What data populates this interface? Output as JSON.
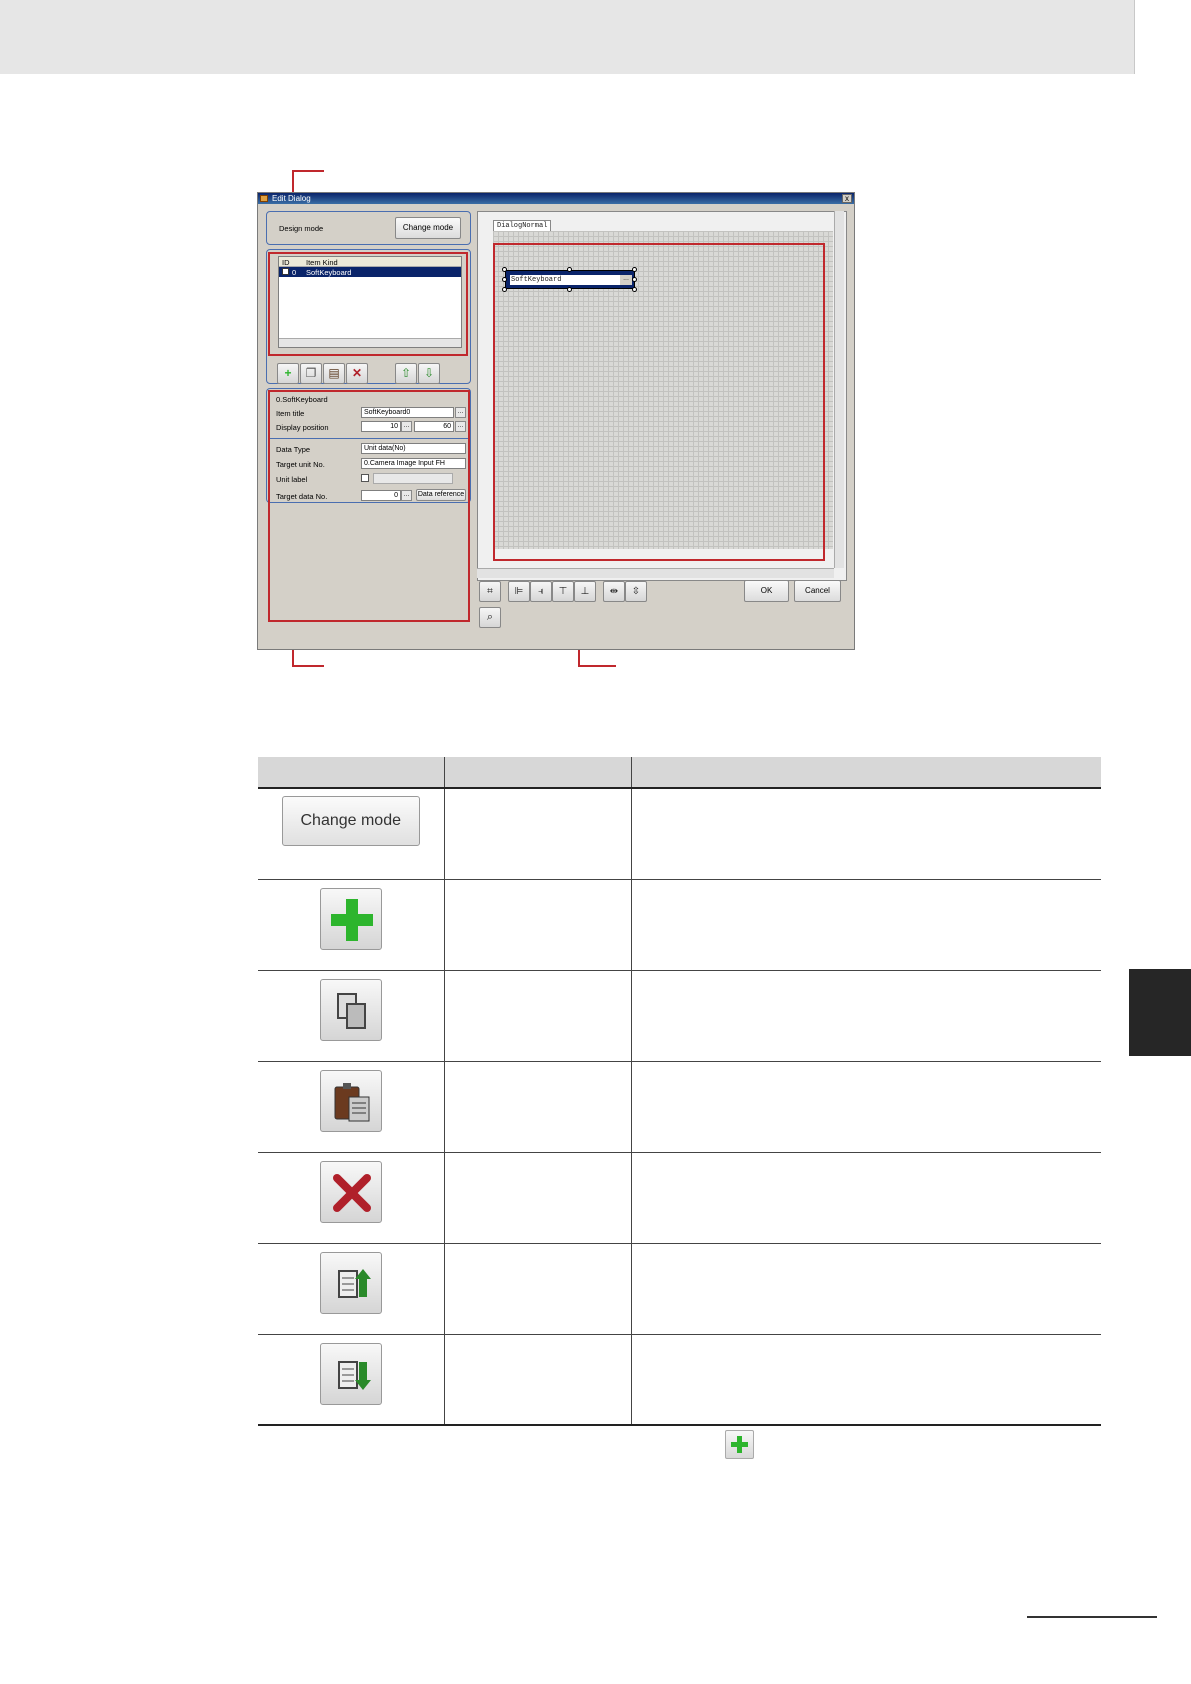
{
  "dialog": {
    "title": "Edit Dialog",
    "close_label": "x",
    "design_mode_label": "Design mode",
    "change_mode_label": "Change mode",
    "list_headers": [
      "ID",
      "Item Kind"
    ],
    "list_item_id": "0",
    "list_item_kind": "SoftKeyboard",
    "props_title": "0.SoftKeyboard",
    "item_title_label": "Item title",
    "item_title_value": "SoftKeyboard0",
    "display_position_label": "Display position",
    "display_x": "10",
    "display_y": "60",
    "data_type_label": "Data Type",
    "data_type_value": "Unit data(No)",
    "target_unit_label": "Target unit No.",
    "target_unit_value": "0.Camera Image Input FH",
    "unit_label_label": "Unit label",
    "target_data_label": "Target data No.",
    "target_data_value": "0",
    "data_reference_label": "Data reference",
    "tab_label": "DialogNormal",
    "canvas_item_text": "SoftKeyboard",
    "ok_label": "OK",
    "cancel_label": "Cancel",
    "ellipsis": "..."
  },
  "table": {
    "rows": [
      {
        "icon": "change-mode-button",
        "label": "Change mode"
      },
      {
        "icon": "add-icon"
      },
      {
        "icon": "copy-icon"
      },
      {
        "icon": "paste-icon"
      },
      {
        "icon": "delete-icon"
      },
      {
        "icon": "move-up-icon"
      },
      {
        "icon": "move-down-icon"
      }
    ]
  },
  "colors": {
    "callout": "#c0282d",
    "add": "#2db52d",
    "delete": "#b0202a",
    "sidetab": "#262626"
  }
}
